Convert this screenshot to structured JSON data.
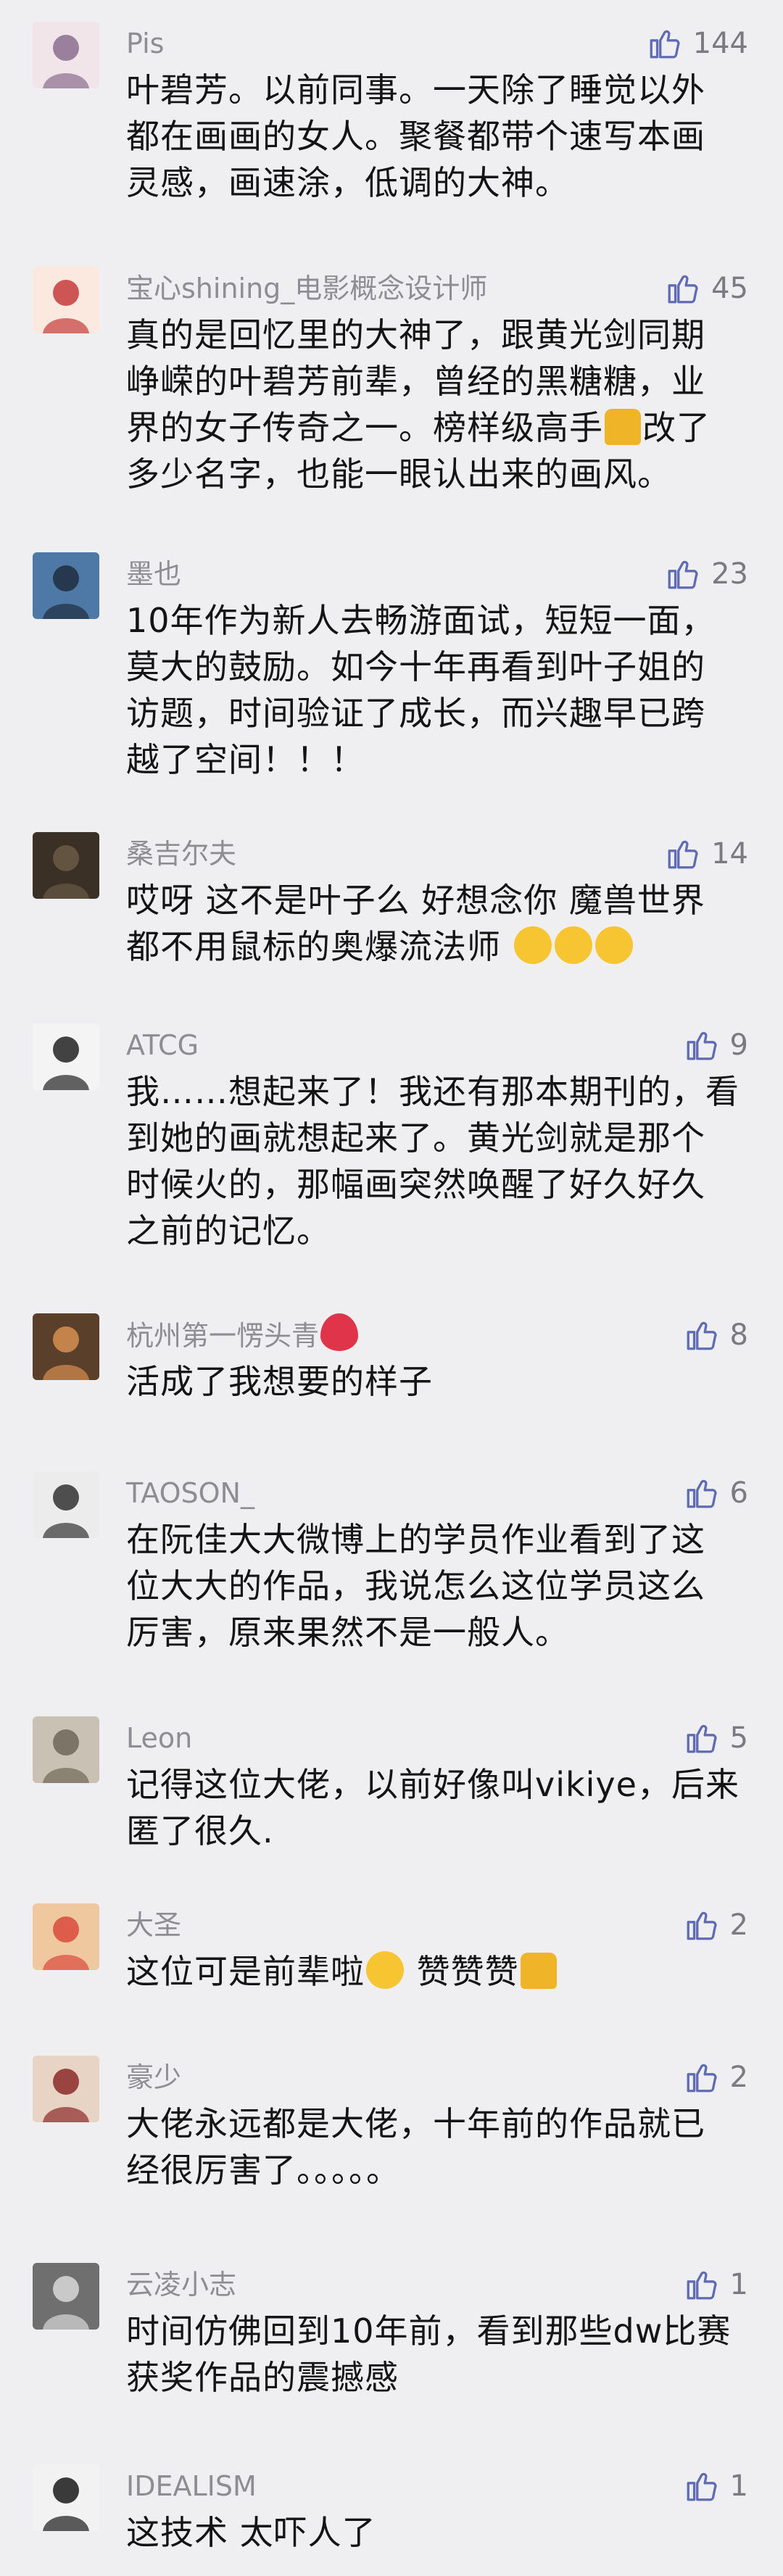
{
  "comments": [
    {
      "name": "Pis",
      "likes": "144",
      "lines": [
        "叶碧芳。以前同事。一天除了睡觉以外",
        "都在画画的女人。聚餐都带个速写本画",
        "灵感，画速涂，低调的大神。"
      ]
    },
    {
      "name": "宝心shining_电影概念设计师",
      "likes": "45",
      "lines": [
        "真的是回忆里的大神了，跟黄光剑同期",
        "峥嵘的叶碧芳前辈，曾经的黑糖糖，业",
        "界的女子传奇之一。榜样级高手👍改了",
        "多少名字，也能一眼认出来的画风。"
      ]
    },
    {
      "name": "墨也",
      "likes": "23",
      "lines": [
        "10年作为新人去畅游面试，短短一面，",
        "莫大的鼓励。如今十年再看到叶子姐的",
        "访题，时间验证了成长，而兴趣早已跨",
        "越了空间！！！"
      ]
    },
    {
      "name": "桑吉尔夫",
      "likes": "14",
      "lines": [
        "哎呀 这不是叶子么 好想念你 魔兽世界",
        "都不用鼠标的奥爆流法师 😂😂😂"
      ]
    },
    {
      "name": "ATCG",
      "likes": "9",
      "lines": [
        "我……想起来了！我还有那本期刊的，看",
        "到她的画就想起来了。黄光剑就是那个",
        "时候火的，那幅画突然唤醒了好久好久",
        "之前的记忆。"
      ]
    },
    {
      "name": "杭州第一愣头青🍓",
      "likes": "8",
      "lines": [
        "活成了我想要的样子"
      ]
    },
    {
      "name": "TAOSON_",
      "likes": "6",
      "lines": [
        "在阮佳大大微博上的学员作业看到了这",
        "位大大的作品，我说怎么这位学员这么",
        "厉害，原来果然不是一般人。"
      ]
    },
    {
      "name": "Leon",
      "likes": "5",
      "lines": [
        "记得这位大佬，以前好像叫vikiye，后来",
        "匿了很久."
      ]
    },
    {
      "name": "大圣",
      "likes": "2",
      "lines": [
        "这位可是前辈啦😄 赞赞赞👍"
      ]
    },
    {
      "name": "豪少",
      "likes": "2",
      "lines": [
        "大佬永远都是大佬，十年前的作品就已",
        "经很厉害了。。。。。"
      ]
    },
    {
      "name": "云凌小志",
      "likes": "1",
      "lines": [
        "时间仿佛回到10年前，看到那些dw比赛",
        "获奖作品的震撼感"
      ]
    },
    {
      "name": "IDEALISM",
      "likes": "1",
      "lines": [
        "这技术 太吓人了"
      ]
    }
  ],
  "icons": {
    "like": "thumbs-up-outline-icon"
  },
  "colors": {
    "like": "#5f6cb3",
    "name": "#8d8d93",
    "text": "#141414"
  }
}
